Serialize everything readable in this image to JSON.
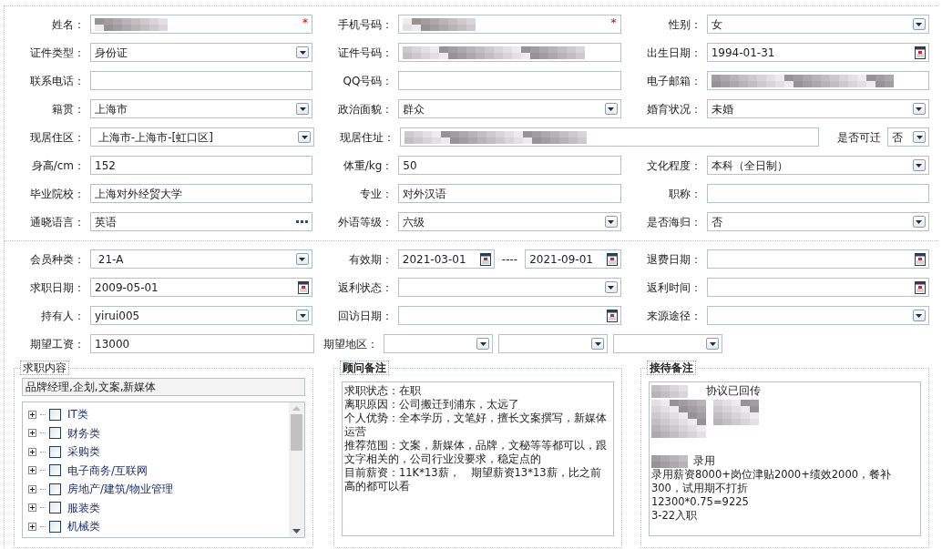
{
  "profile_rows": [
    [
      {
        "label": "姓名：",
        "controls": [
          {
            "kind": "text",
            "redacted": true,
            "required_mark": "*"
          }
        ]
      },
      {
        "label": "手机号码：",
        "controls": [
          {
            "kind": "text",
            "redacted": true,
            "required_mark": "*"
          }
        ]
      },
      {
        "label": "性别：",
        "controls": [
          {
            "kind": "select",
            "value": "女"
          }
        ]
      }
    ],
    [
      {
        "label": "证件类型：",
        "controls": [
          {
            "kind": "select",
            "value": "身份证"
          }
        ]
      },
      {
        "label": "证件号码：",
        "controls": [
          {
            "kind": "text",
            "redacted": true
          }
        ]
      },
      {
        "label": "出生日期：",
        "controls": [
          {
            "kind": "date",
            "value": "1994-01-31"
          }
        ]
      }
    ],
    [
      {
        "label": "联系电话：",
        "controls": [
          {
            "kind": "text"
          }
        ]
      },
      {
        "label": "QQ号码：",
        "controls": [
          {
            "kind": "text"
          }
        ]
      },
      {
        "label": "电子邮箱：",
        "controls": [
          {
            "kind": "text",
            "redacted": true
          }
        ]
      }
    ],
    [
      {
        "label": "籍贯：",
        "controls": [
          {
            "kind": "select",
            "value": "上海市"
          }
        ]
      },
      {
        "label": "政治面貌：",
        "controls": [
          {
            "kind": "select",
            "value": "群众"
          }
        ]
      },
      {
        "label": "婚育状况：",
        "controls": [
          {
            "kind": "select",
            "value": "未婚"
          }
        ]
      }
    ],
    [
      {
        "label": "现居住区：",
        "controls": [
          {
            "kind": "select",
            "value": " 上海市-上海市-[虹口区]"
          }
        ]
      },
      {
        "label": "现居住址：",
        "controls": [
          {
            "kind": "text",
            "redacted": true
          }
        ]
      },
      {
        "label": "是否可迁",
        "inline": true,
        "controls": [
          {
            "kind": "select",
            "value": "否"
          }
        ]
      }
    ],
    [
      {
        "label": "身高/cm：",
        "controls": [
          {
            "kind": "text",
            "value": "152"
          }
        ]
      },
      {
        "label": "体重/kg：",
        "controls": [
          {
            "kind": "text",
            "value": "50"
          }
        ]
      },
      {
        "label": "文化程度：",
        "controls": [
          {
            "kind": "select",
            "value": "本科（全日制）"
          }
        ]
      }
    ],
    [
      {
        "label": "毕业院校：",
        "controls": [
          {
            "kind": "text",
            "value": "上海对外经贸大学"
          }
        ]
      },
      {
        "label": "专业：",
        "controls": [
          {
            "kind": "text",
            "value": "对外汉语"
          }
        ]
      },
      {
        "label": "职称：",
        "controls": [
          {
            "kind": "text"
          }
        ]
      }
    ],
    [
      {
        "label": "通晓语言：",
        "controls": [
          {
            "kind": "lookup",
            "value": "英语"
          }
        ]
      },
      {
        "label": "外语等级：",
        "controls": [
          {
            "kind": "select",
            "value": "六级"
          }
        ]
      },
      {
        "label": "是否海归：",
        "controls": [
          {
            "kind": "select",
            "value": "否"
          }
        ]
      }
    ]
  ],
  "membership_rows": [
    [
      {
        "label": "会员种类：",
        "controls": [
          {
            "kind": "select",
            "value": " 21-A"
          }
        ]
      },
      {
        "label": "有效期：",
        "separator": "----",
        "controls": [
          {
            "kind": "date",
            "value": "2021-03-01"
          },
          {
            "kind": "date",
            "value": "2021-09-01"
          }
        ]
      },
      {
        "label": "退费日期：",
        "controls": [
          {
            "kind": "date"
          }
        ]
      }
    ],
    [
      {
        "label": "求职日期：",
        "controls": [
          {
            "kind": "date",
            "value": "2009-05-01"
          }
        ]
      },
      {
        "label": "返利状态：",
        "controls": [
          {
            "kind": "select"
          }
        ]
      },
      {
        "label": "返利时间：",
        "controls": [
          {
            "kind": "date"
          }
        ]
      }
    ],
    [
      {
        "label": "持有人：",
        "controls": [
          {
            "kind": "select",
            "value": "yirui005"
          }
        ]
      },
      {
        "label": "回访日期：",
        "controls": [
          {
            "kind": "date"
          }
        ]
      },
      {
        "label": "来源途径：",
        "controls": [
          {
            "kind": "select"
          }
        ]
      }
    ],
    [
      {
        "label": "期望工资：",
        "controls": [
          {
            "kind": "text",
            "value": "13000"
          }
        ]
      },
      {
        "label": "期望地区：",
        "controls": [
          {
            "kind": "select"
          },
          {
            "kind": "select"
          },
          {
            "kind": "select"
          }
        ]
      }
    ]
  ],
  "job_panel": {
    "title": "求职内容",
    "emphasized": false,
    "summary": "品牌经理,企划,文案,新媒体",
    "categories": [
      {
        "label": "IT类",
        "expanded": false,
        "checked": false
      },
      {
        "label": "财务类",
        "expanded": false,
        "checked": false
      },
      {
        "label": "采购类",
        "expanded": false,
        "checked": false
      },
      {
        "label": "电子商务/互联网",
        "expanded": false,
        "checked": false
      },
      {
        "label": "房地产/建筑/物业管理",
        "expanded": false,
        "checked": false
      },
      {
        "label": "服装类",
        "expanded": false,
        "checked": false
      },
      {
        "label": "机械类",
        "expanded": false,
        "checked": false
      }
    ]
  },
  "note_panels": [
    {
      "title": "顾问备注",
      "emphasized": true,
      "lines": [
        {
          "kind": "text",
          "text": "求职状态：在职"
        },
        {
          "kind": "text",
          "text": "离职原因：公司搬迁到浦东，太远了"
        },
        {
          "kind": "text",
          "text": "个人优势：全本学历，文笔好，擅长文案撰写，新媒体运营"
        },
        {
          "kind": "text",
          "text": "推荐范围：文案，新媒体，品牌，文秘等等都可以，跟文字相关的，公司行业没要求，稳定点的"
        },
        {
          "kind": "text",
          "text": "目前薪资：11K*13薪，　期望薪资13*13薪，比之前高的都可以看"
        }
      ]
    },
    {
      "title": "接待备注",
      "emphasized": true,
      "lines": [
        {
          "kind": "redacted",
          "text": "协议已回传"
        },
        {
          "kind": "redacted_block"
        },
        {
          "kind": "gap"
        },
        {
          "kind": "redacted",
          "text": "录用"
        },
        {
          "kind": "text",
          "text": "录用薪资8000+岗位津贴2000+绩效2000，餐补300，试用期不打折"
        },
        {
          "kind": "text",
          "text": "12300*0.75=9225"
        },
        {
          "kind": "text",
          "text": "3-22入职"
        }
      ]
    }
  ]
}
